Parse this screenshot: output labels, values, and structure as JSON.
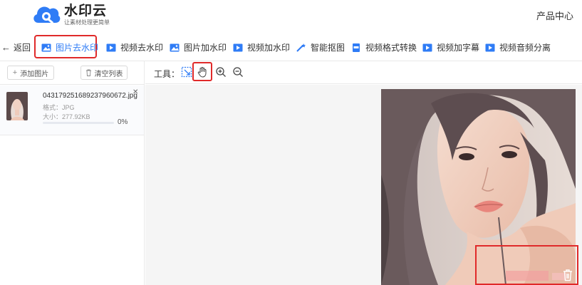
{
  "header": {
    "logo_name": "水印云",
    "logo_slogan": "让素材处理更简单",
    "product_center": "产品中心"
  },
  "nav": {
    "back_label": "返回",
    "items": [
      {
        "label": "图片去水印",
        "icon": "image-icon",
        "active": true
      },
      {
        "label": "视频去水印",
        "icon": "video-icon",
        "active": false
      },
      {
        "label": "图片加水印",
        "icon": "image-icon",
        "active": false
      },
      {
        "label": "视频加水印",
        "icon": "video-icon",
        "active": false
      },
      {
        "label": "智能抠图",
        "icon": "magic-wand-icon",
        "active": false
      },
      {
        "label": "视频格式转换",
        "icon": "mp4-file-icon",
        "active": false
      },
      {
        "label": "视频加字幕",
        "icon": "video-icon",
        "active": false
      },
      {
        "label": "视频音频分离",
        "icon": "video-icon",
        "active": false
      }
    ]
  },
  "left_panel": {
    "add_button": "添加图片",
    "clear_button": "清空列表",
    "file": {
      "name": "0431792516892379606​72.jpg",
      "format": "格式：JPG",
      "size": "大小：277.92KB",
      "progress_percent": 0,
      "progress_label": "0%"
    }
  },
  "toolbar": {
    "label": "工具：",
    "tools": [
      "select-box-icon",
      "hand-icon",
      "zoom-in-icon",
      "zoom-out-icon"
    ]
  },
  "colors": {
    "accent": "#2f7cf6",
    "highlight_red": "#e02a2a"
  }
}
